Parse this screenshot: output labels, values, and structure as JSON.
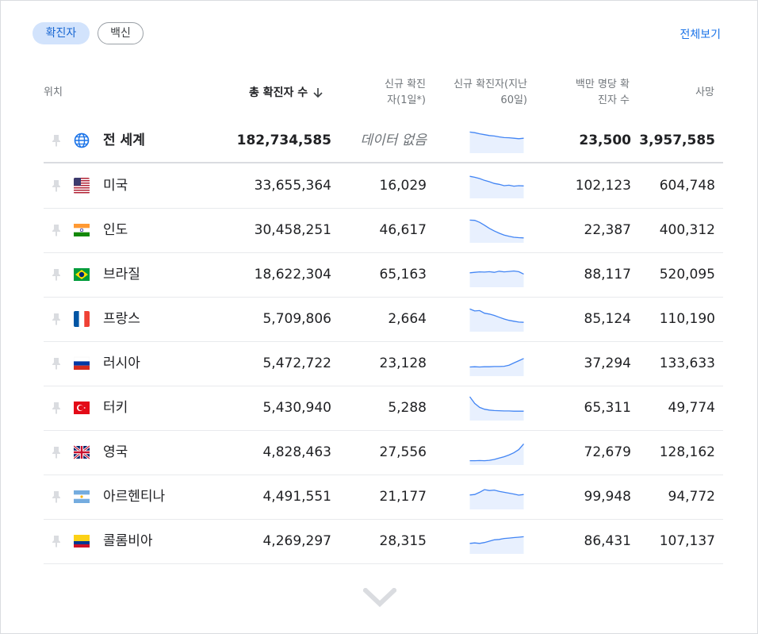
{
  "filters": [
    {
      "label": "확진자",
      "active": true
    },
    {
      "label": "백신",
      "active": false
    }
  ],
  "view_all": "전체보기",
  "headers": {
    "location": "위치",
    "total_cases": "총 확진자 수",
    "new_cases_line1": "신규 확진",
    "new_cases_line2": "자(1일*)",
    "trend_line1": "신규 확진자(지난",
    "trend_line2": "60일)",
    "per_million_line1": "백만 명당 확",
    "per_million_line2": "진자 수",
    "deaths": "사망"
  },
  "rows": [
    {
      "name": "전 세계",
      "flag": "globe-icon",
      "total": "182,734,585",
      "new": "데이터 없음",
      "per_million": "23,500",
      "deaths": "3,957,585",
      "trend": [
        88,
        85,
        80,
        76,
        72,
        70,
        66,
        63,
        62,
        60,
        58,
        60
      ]
    },
    {
      "name": "미국",
      "flag": "us-flag-icon",
      "total": "33,655,364",
      "new": "16,029",
      "per_million": "102,123",
      "deaths": "604,748",
      "trend": [
        92,
        88,
        82,
        74,
        68,
        60,
        56,
        50,
        52,
        48,
        50,
        49
      ]
    },
    {
      "name": "인도",
      "flag": "india-flag-icon",
      "total": "30,458,251",
      "new": "46,617",
      "per_million": "22,387",
      "deaths": "400,312",
      "trend": [
        95,
        94,
        85,
        72,
        58,
        46,
        36,
        28,
        22,
        18,
        16,
        15
      ]
    },
    {
      "name": "브라질",
      "flag": "brazil-flag-icon",
      "total": "18,622,304",
      "new": "65,163",
      "per_million": "88,117",
      "deaths": "520,095",
      "trend": [
        58,
        60,
        62,
        61,
        63,
        60,
        65,
        62,
        64,
        66,
        63,
        52
      ]
    },
    {
      "name": "프랑스",
      "flag": "france-flag-icon",
      "total": "5,709,806",
      "new": "2,664",
      "per_million": "85,124",
      "deaths": "110,190",
      "trend": [
        95,
        86,
        88,
        76,
        72,
        66,
        58,
        50,
        44,
        40,
        36,
        35
      ]
    },
    {
      "name": "러시아",
      "flag": "russia-flag-icon",
      "total": "5,472,722",
      "new": "23,128",
      "per_million": "37,294",
      "deaths": "133,633",
      "trend": [
        34,
        35,
        34,
        35,
        35,
        36,
        36,
        37,
        42,
        52,
        62,
        72
      ]
    },
    {
      "name": "터키",
      "flag": "turkey-flag-icon",
      "total": "5,430,940",
      "new": "5,288",
      "per_million": "65,311",
      "deaths": "49,774",
      "trend": [
        100,
        70,
        52,
        44,
        40,
        38,
        37,
        36,
        36,
        35,
        35,
        35
      ]
    },
    {
      "name": "영국",
      "flag": "uk-flag-icon",
      "total": "4,828,463",
      "new": "27,556",
      "per_million": "72,679",
      "deaths": "128,162",
      "trend": [
        12,
        12,
        13,
        12,
        14,
        18,
        24,
        30,
        38,
        48,
        62,
        88
      ]
    },
    {
      "name": "아르헨티나",
      "flag": "argentina-flag-icon",
      "total": "4,491,551",
      "new": "21,177",
      "per_million": "99,948",
      "deaths": "94,772",
      "trend": [
        58,
        60,
        70,
        82,
        78,
        80,
        74,
        70,
        66,
        62,
        57,
        60
      ]
    },
    {
      "name": "콜롬비아",
      "flag": "colombia-flag-icon",
      "total": "4,269,297",
      "new": "28,315",
      "per_million": "86,431",
      "deaths": "107,137",
      "trend": [
        40,
        42,
        40,
        44,
        50,
        56,
        58,
        62,
        64,
        66,
        68,
        70
      ]
    }
  ],
  "colors": {
    "accent": "#1a73e8",
    "chip_bg": "#d2e3fc",
    "spark_line": "#4285f4",
    "spark_fill": "#e8f0fe"
  }
}
